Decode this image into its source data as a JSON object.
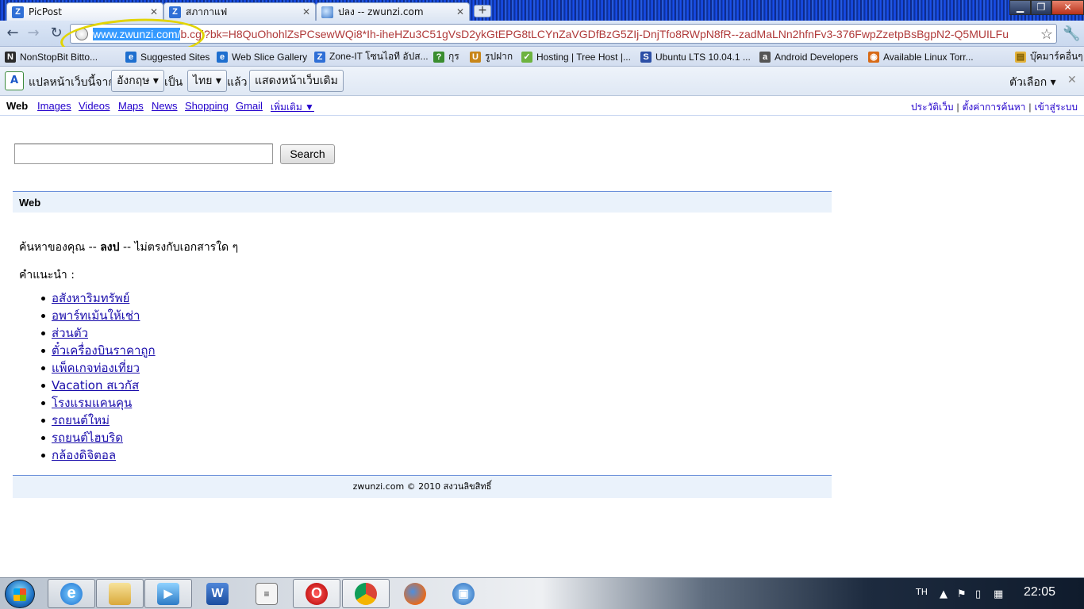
{
  "tabs": [
    {
      "label": "PicPost",
      "active": true
    },
    {
      "label": "สภากาแฟ",
      "active": false
    },
    {
      "label": "ปลง -- zwunzi.com",
      "active": false
    }
  ],
  "window_controls": {
    "minimize": "▁",
    "maximize": "❐",
    "close": "✕"
  },
  "omnibox": {
    "domain": "www.zwunzi.com/",
    "path": "b.cgi?bk=H8QuOhohlZsPCsewWQi8*Ih-iheHZu3C51gVsD2ykGtEPG8tLCYnZaVGDfBzG5ZIj-DnjTfo8RWpN8fR--zadMaLNn2hfnFv3-376FwpZzetpBsBgpN2-Q5MUILFu",
    "star": "☆"
  },
  "bookmarks": [
    {
      "label": "NonStopBit Bitto...",
      "icon": "N"
    },
    {
      "label": "Suggested Sites",
      "icon": "e"
    },
    {
      "label": "Web Slice Gallery",
      "icon": "e"
    },
    {
      "label": "Zone-IT โซนไอที อัปส...",
      "icon": "Z"
    },
    {
      "label": "กุร",
      "icon": "?"
    },
    {
      "label": "รูปฝาก",
      "icon": "U"
    },
    {
      "label": "Hosting | Tree Host |...",
      "icon": "✓"
    },
    {
      "label": "Ubuntu LTS 10.04.1 ...",
      "icon": "S"
    },
    {
      "label": "Android Developers",
      "icon": "a"
    },
    {
      "label": "Available Linux Torr...",
      "icon": "◉"
    },
    {
      "label": "บุ๊คมาร์คอื่นๆ",
      "icon": "▤"
    }
  ],
  "translate_bar": {
    "prefix": "แปลหน้าเว็บนี้จาก",
    "from_lang": "อังกฤษ ▾",
    "to_word": "เป็น",
    "to_lang": "ไทย ▾",
    "after_word": "แล้ว",
    "show_original": "แสดงหน้าเว็บเดิม",
    "options": "ตัวเลือก ▾",
    "close": "✕"
  },
  "gbar": {
    "items": [
      "Web",
      "Images",
      "Videos",
      "Maps",
      "News",
      "Shopping",
      "Gmail",
      "เพิ่มเติม ▼"
    ],
    "right": [
      "ประวัติเว็บ",
      "ตั้งค่าการค้นหา",
      "เข้าสู่ระบบ"
    ]
  },
  "search": {
    "button": "Search",
    "value": ""
  },
  "results_header": "Web",
  "no_results": {
    "before": "ค้นหาของคุณ -- ",
    "query": "ลงป",
    "after": " -- ไม่ตรงกับเอกสารใด ๆ"
  },
  "suggest_label": "คำแนะนำ :",
  "suggestions": [
    "อสังหาริมทรัพย์",
    "อพาร์ทเม้นให้เช่า",
    "ส่วนตัว",
    "ตั๋วเครื่องบินราคาถูก",
    "แพ็คเกจท่องเที่ยว",
    "Vacation สเวกัส",
    "โรงแรมแคนคุน",
    "รถยนต์ใหม่",
    "รถยนต์ไฮบริด",
    "กล้องดิจิตอล"
  ],
  "footer": "zwunzi.com © 2010 สงวนลิขสิทธิ์",
  "taskbar": {
    "lang": "TH",
    "clock": "22:05"
  }
}
